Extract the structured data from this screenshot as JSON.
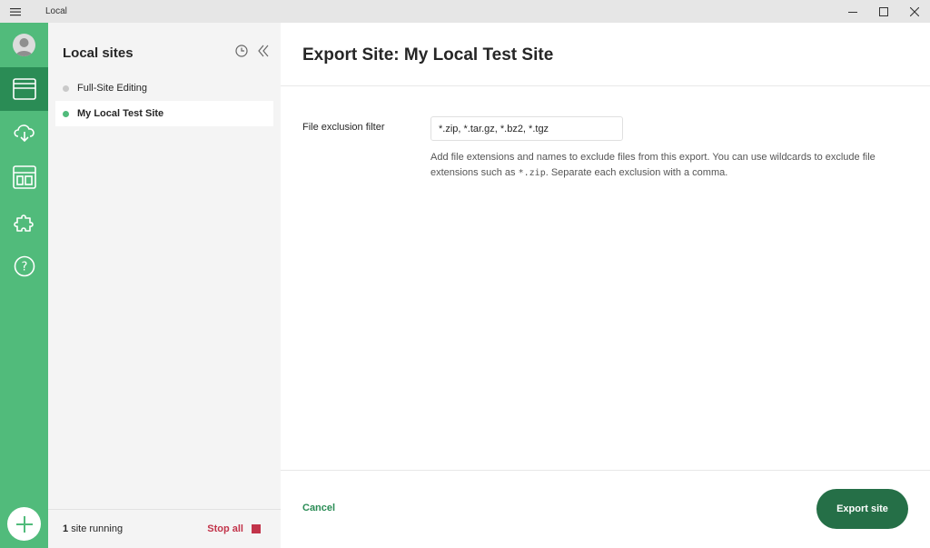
{
  "window": {
    "title": "Local"
  },
  "sidebar": {
    "title": "Local sites",
    "sites": [
      {
        "label": "Full-Site Editing",
        "status_color": "#c9c9c9"
      },
      {
        "label": "My Local Test Site",
        "status_color": "#51bb7b"
      }
    ],
    "footer": {
      "running_count": "1",
      "running_label": "site running",
      "stop_all_label": "Stop all"
    }
  },
  "main": {
    "title": "Export Site: My Local Test Site",
    "filter": {
      "label": "File exclusion filter",
      "value": "*.zip, *.tar.gz, *.bz2, *.tgz",
      "help_before": "Add file extensions and names to exclude files from this export. You can use wildcards to exclude file extensions such as ",
      "help_code": "*.zip",
      "help_after": ". Separate each exclusion with a comma."
    },
    "cancel_label": "Cancel",
    "export_label": "Export site"
  },
  "colors": {
    "accent": "#51bb7b",
    "accent_dark": "#2a8c55",
    "button": "#256f47",
    "danger": "#c2344a"
  },
  "icons": [
    "menu-icon",
    "minimize-icon",
    "maximize-icon",
    "close-icon",
    "avatar-icon",
    "sites-icon",
    "cloud-icon",
    "blueprints-icon",
    "addons-icon",
    "help-icon",
    "add-icon",
    "history-icon",
    "collapse-icon"
  ]
}
